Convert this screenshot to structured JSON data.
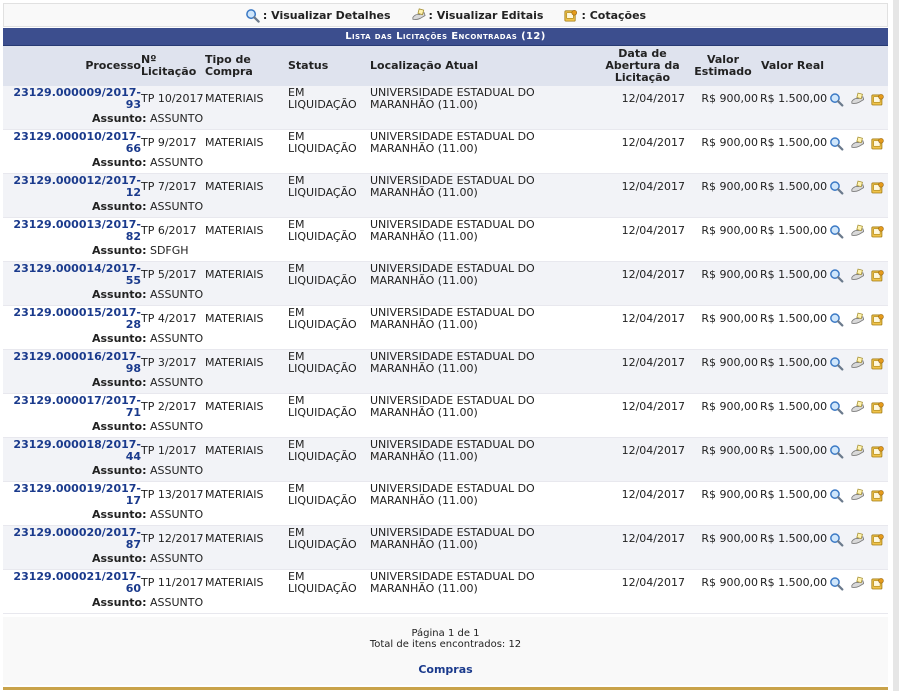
{
  "legend": {
    "detalhes": "Visualizar Detalhes",
    "editais": "Visualizar Editais",
    "cotacoes": "Cotações"
  },
  "table": {
    "caption": "Lista das Licitações Encontradas (12)",
    "headers": {
      "processo": "Processo",
      "licitacao": "Nº Licitação",
      "tipo": "Tipo de Compra",
      "status": "Status",
      "localizacao": "Localização Atual",
      "data": "Data de Abertura da Licitação",
      "valor_estimado": "Valor Estimado",
      "valor_real": "Valor Real"
    },
    "assunto_label": "Assunto:",
    "rows": [
      {
        "processo": "23129.000009/2017-93",
        "licitacao": "TP 10/2017",
        "tipo": "MATERIAIS",
        "status": "EM LIQUIDAÇÃO",
        "localizacao": "UNIVERSIDADE ESTADUAL DO MARANHÃO (11.00)",
        "data": "12/04/2017",
        "valor_estimado": "R$ 900,00",
        "valor_real": "R$ 1.500,00",
        "assunto": "ASSUNTO"
      },
      {
        "processo": "23129.000010/2017-66",
        "licitacao": "TP 9/2017",
        "tipo": "MATERIAIS",
        "status": "EM LIQUIDAÇÃO",
        "localizacao": "UNIVERSIDADE ESTADUAL DO MARANHÃO (11.00)",
        "data": "12/04/2017",
        "valor_estimado": "R$ 900,00",
        "valor_real": "R$ 1.500,00",
        "assunto": "ASSUNTO"
      },
      {
        "processo": "23129.000012/2017-12",
        "licitacao": "TP 7/2017",
        "tipo": "MATERIAIS",
        "status": "EM LIQUIDAÇÃO",
        "localizacao": "UNIVERSIDADE ESTADUAL DO MARANHÃO (11.00)",
        "data": "12/04/2017",
        "valor_estimado": "R$ 900,00",
        "valor_real": "R$ 1.500,00",
        "assunto": "ASSUNTO"
      },
      {
        "processo": "23129.000013/2017-82",
        "licitacao": "TP 6/2017",
        "tipo": "MATERIAIS",
        "status": "EM LIQUIDAÇÃO",
        "localizacao": "UNIVERSIDADE ESTADUAL DO MARANHÃO (11.00)",
        "data": "12/04/2017",
        "valor_estimado": "R$ 900,00",
        "valor_real": "R$ 1.500,00",
        "assunto": "SDFGH"
      },
      {
        "processo": "23129.000014/2017-55",
        "licitacao": "TP 5/2017",
        "tipo": "MATERIAIS",
        "status": "EM LIQUIDAÇÃO",
        "localizacao": "UNIVERSIDADE ESTADUAL DO MARANHÃO (11.00)",
        "data": "12/04/2017",
        "valor_estimado": "R$ 900,00",
        "valor_real": "R$ 1.500,00",
        "assunto": "ASSUNTO"
      },
      {
        "processo": "23129.000015/2017-28",
        "licitacao": "TP 4/2017",
        "tipo": "MATERIAIS",
        "status": "EM LIQUIDAÇÃO",
        "localizacao": "UNIVERSIDADE ESTADUAL DO MARANHÃO (11.00)",
        "data": "12/04/2017",
        "valor_estimado": "R$ 900,00",
        "valor_real": "R$ 1.500,00",
        "assunto": "ASSUNTO"
      },
      {
        "processo": "23129.000016/2017-98",
        "licitacao": "TP 3/2017",
        "tipo": "MATERIAIS",
        "status": "EM LIQUIDAÇÃO",
        "localizacao": "UNIVERSIDADE ESTADUAL DO MARANHÃO (11.00)",
        "data": "12/04/2017",
        "valor_estimado": "R$ 900,00",
        "valor_real": "R$ 1.500,00",
        "assunto": "ASSUNTO"
      },
      {
        "processo": "23129.000017/2017-71",
        "licitacao": "TP 2/2017",
        "tipo": "MATERIAIS",
        "status": "EM LIQUIDAÇÃO",
        "localizacao": "UNIVERSIDADE ESTADUAL DO MARANHÃO (11.00)",
        "data": "12/04/2017",
        "valor_estimado": "R$ 900,00",
        "valor_real": "R$ 1.500,00",
        "assunto": "ASSUNTO"
      },
      {
        "processo": "23129.000018/2017-44",
        "licitacao": "TP 1/2017",
        "tipo": "MATERIAIS",
        "status": "EM LIQUIDAÇÃO",
        "localizacao": "UNIVERSIDADE ESTADUAL DO MARANHÃO (11.00)",
        "data": "12/04/2017",
        "valor_estimado": "R$ 900,00",
        "valor_real": "R$ 1.500,00",
        "assunto": "ASSUNTO"
      },
      {
        "processo": "23129.000019/2017-17",
        "licitacao": "TP 13/2017",
        "tipo": "MATERIAIS",
        "status": "EM LIQUIDAÇÃO",
        "localizacao": "UNIVERSIDADE ESTADUAL DO MARANHÃO (11.00)",
        "data": "12/04/2017",
        "valor_estimado": "R$ 900,00",
        "valor_real": "R$ 1.500,00",
        "assunto": "ASSUNTO"
      },
      {
        "processo": "23129.000020/2017-87",
        "licitacao": "TP 12/2017",
        "tipo": "MATERIAIS",
        "status": "EM LIQUIDAÇÃO",
        "localizacao": "UNIVERSIDADE ESTADUAL DO MARANHÃO (11.00)",
        "data": "12/04/2017",
        "valor_estimado": "R$ 900,00",
        "valor_real": "R$ 1.500,00",
        "assunto": "ASSUNTO"
      },
      {
        "processo": "23129.000021/2017-60",
        "licitacao": "TP 11/2017",
        "tipo": "MATERIAIS",
        "status": "EM LIQUIDAÇÃO",
        "localizacao": "UNIVERSIDADE ESTADUAL DO MARANHÃO (11.00)",
        "data": "12/04/2017",
        "valor_estimado": "R$ 900,00",
        "valor_real": "R$ 1.500,00",
        "assunto": "ASSUNTO"
      }
    ]
  },
  "footer": {
    "pagina": "Página 1 de 1",
    "total": "Total de itens encontrados: 12",
    "compras_link": "Compras"
  },
  "icons": {
    "detalhes": "magnifier-icon",
    "editais": "hand-document-icon",
    "cotacoes": "quotation-icon"
  },
  "colors": {
    "caption_bg": "#3c4e8e",
    "header_bg": "#dfe3ee",
    "link": "#1a3a8c",
    "odd_row": "#f2f3f7",
    "bottom_bar": "#c9a34a"
  }
}
